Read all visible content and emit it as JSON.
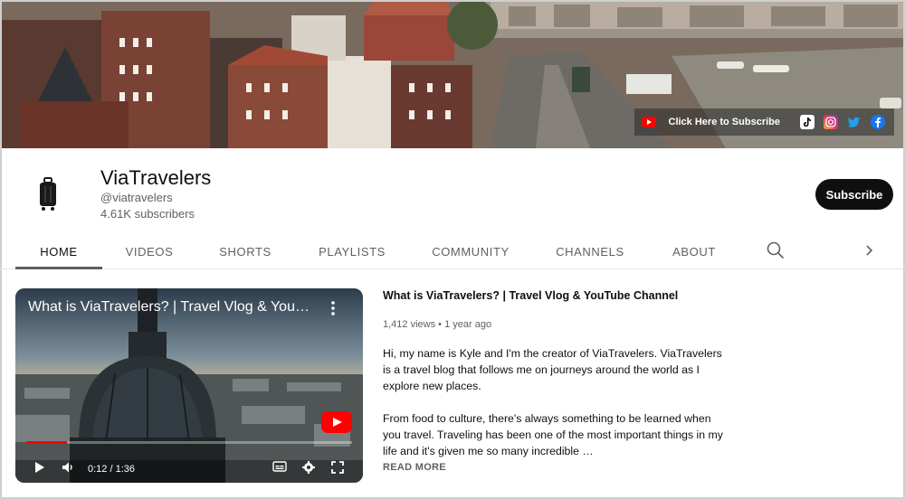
{
  "banner": {
    "cta_label": "Click Here to Subscribe",
    "social_icons": [
      "youtube-icon",
      "tiktok-icon",
      "instagram-icon",
      "twitter-icon",
      "facebook-icon"
    ]
  },
  "channel": {
    "name": "ViaTravelers",
    "handle": "@viatravelers",
    "subscribers": "4.61K subscribers",
    "avatar_icon": "suitcase-icon"
  },
  "subscribe_label": "Subscribe",
  "tabs": [
    {
      "label": "HOME",
      "active": true
    },
    {
      "label": "VIDEOS",
      "active": false
    },
    {
      "label": "SHORTS",
      "active": false
    },
    {
      "label": "PLAYLISTS",
      "active": false
    },
    {
      "label": "COMMUNITY",
      "active": false
    },
    {
      "label": "CHANNELS",
      "active": false
    },
    {
      "label": "ABOUT",
      "active": false
    }
  ],
  "featured_video": {
    "overlay_title": "What is ViaTravelers? | Travel Vlog & YouTube Channel",
    "time_display": "0:12 / 1:36",
    "progress": 0.125,
    "title": "What is ViaTravelers? | Travel Vlog & YouTube Channel",
    "views": "1,412 views",
    "age": "1 year ago",
    "description_p1": "Hi, my name is Kyle and I'm the creator of ViaTravelers. ViaTravelers is a travel blog that follows me on journeys around the world as I explore new places.",
    "description_p2": "From food to culture, there's always something to be learned when you travel. Traveling has been one of the most important things in my life and it's given me so many incredible …",
    "read_more": "READ MORE"
  },
  "colors": {
    "subscribe_bg": "#0f0f0f",
    "youtube_red": "#ff0000",
    "muted_text": "#606060"
  }
}
